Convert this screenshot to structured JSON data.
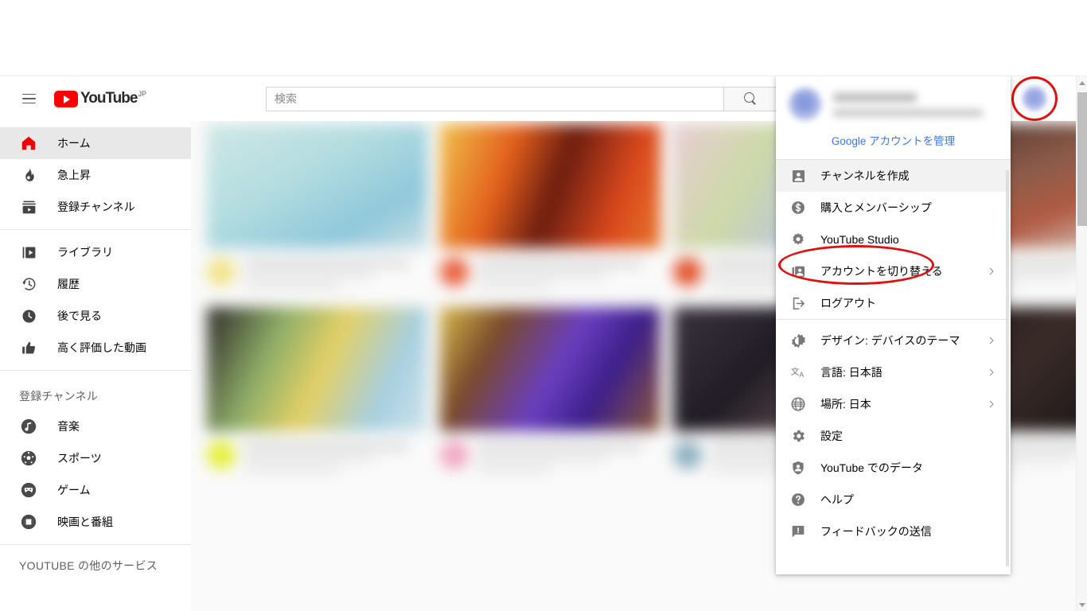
{
  "app": {
    "name": "YouTube",
    "locale_badge": "JP"
  },
  "masthead": {
    "menu_icon": "hamburger-icon",
    "logo_text": "YouTube",
    "logo_superscript": "JP",
    "search": {
      "placeholder": "検索",
      "value": "",
      "button_icon": "search-icon"
    },
    "avatar_icon": "account-avatar"
  },
  "sidebar": {
    "primary": [
      {
        "icon": "home-icon",
        "label": "ホーム",
        "active": true
      },
      {
        "icon": "trending-icon",
        "label": "急上昇",
        "active": false
      },
      {
        "icon": "subscriptions-icon",
        "label": "登録チャンネル",
        "active": false
      }
    ],
    "library": [
      {
        "icon": "library-icon",
        "label": "ライブラリ"
      },
      {
        "icon": "history-icon",
        "label": "履歴"
      },
      {
        "icon": "watch-later-icon",
        "label": "後で見る"
      },
      {
        "icon": "thumbs-up-icon",
        "label": "高く評価した動画"
      }
    ],
    "subscriptions_heading": "登録チャンネル",
    "subscriptions": [
      {
        "icon": "music-note-icon",
        "label": "音楽"
      },
      {
        "icon": "sports-ball-icon",
        "label": "スポーツ"
      },
      {
        "icon": "gaming-icon",
        "label": "ゲーム"
      },
      {
        "icon": "film-icon",
        "label": "映画と番組"
      }
    ],
    "more_heading": "YOUTUBE の他のサービス"
  },
  "account_menu": {
    "account_name": "",
    "account_email": "",
    "manage_link": "Google アカウントを管理",
    "group_1": [
      {
        "icon": "person-box-icon",
        "label": "チャンネルを作成",
        "chevron": false,
        "highlighted": true
      },
      {
        "icon": "dollar-circle-icon",
        "label": "購入とメンバーシップ",
        "chevron": false,
        "highlighted": false
      },
      {
        "icon": "studio-gear-icon",
        "label": "YouTube Studio",
        "chevron": false,
        "highlighted": false
      },
      {
        "icon": "switch-account-icon",
        "label": "アカウントを切り替える",
        "chevron": true,
        "highlighted": false
      },
      {
        "icon": "sign-out-icon",
        "label": "ログアウト",
        "chevron": false,
        "highlighted": false
      }
    ],
    "group_2": [
      {
        "icon": "brightness-icon",
        "label": "デザイン: デバイスのテーマ",
        "chevron": true,
        "highlighted": false
      },
      {
        "icon": "translate-icon",
        "label": "言語: 日本語",
        "chevron": true,
        "highlighted": false
      },
      {
        "icon": "globe-icon",
        "label": "場所: 日本",
        "chevron": true,
        "highlighted": false
      },
      {
        "icon": "settings-gear-icon",
        "label": "設定",
        "chevron": false,
        "highlighted": false
      },
      {
        "icon": "shield-person-icon",
        "label": "YouTube でのデータ",
        "chevron": false,
        "highlighted": false
      },
      {
        "icon": "help-icon",
        "label": "ヘルプ",
        "chevron": false,
        "highlighted": false
      },
      {
        "icon": "feedback-icon",
        "label": "フィードバックの送信",
        "chevron": false,
        "highlighted": false
      }
    ]
  },
  "annotations": [
    {
      "name": "avatar-highlight",
      "shape": "ellipse",
      "color": "#e11010"
    },
    {
      "name": "create-channel-highlight",
      "shape": "ellipse",
      "color": "#e11010"
    }
  ],
  "scrollbar": {
    "up_icon": "scroll-up-arrow",
    "down_icon": "scroll-down-arrow"
  },
  "colors": {
    "brand_red": "#ff0000",
    "link_blue": "#3b78e7",
    "annotation_red": "#e11010",
    "active_row": "#e8e8e8",
    "hover_row": "#f2f2f2"
  },
  "video_grid": {
    "note": "blurred video thumbnails",
    "thumb_colors": [
      "#bfdde0",
      "#d84f1c",
      "#e6c9cd",
      "#5a4036",
      "#8fa86a",
      "#6a4aa8",
      "#2c2630",
      "#1c1a1a"
    ]
  }
}
